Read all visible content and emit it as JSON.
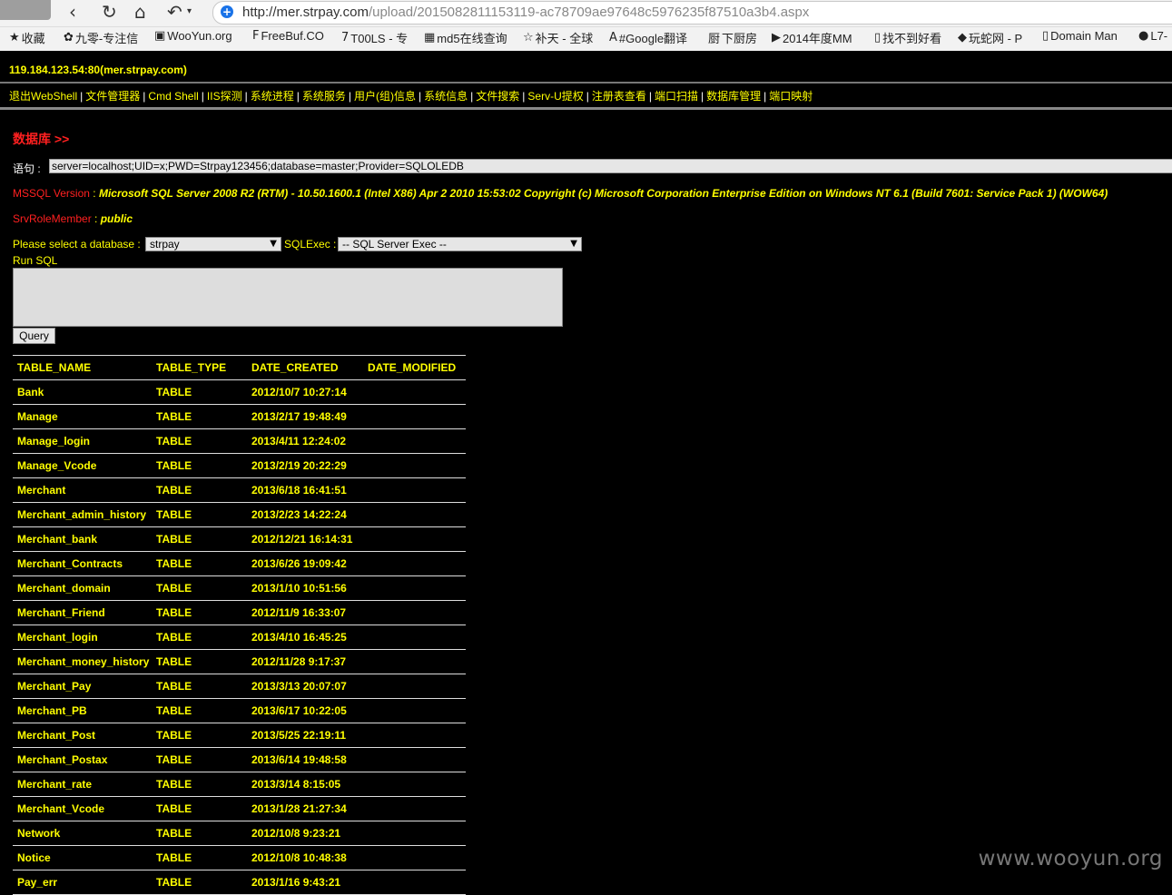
{
  "browser": {
    "url_host": "http://mer.strpay.com",
    "url_path": "/upload/2015082811153119-ac78709ae97648c5976235f87510a3b4.aspx",
    "bookmarks": [
      {
        "icon": "star-icon",
        "label": "收藏"
      },
      {
        "icon": "leaf-icon",
        "label": "九零-专注信"
      },
      {
        "icon": "page-icon",
        "label": "WooYun.org"
      },
      {
        "icon": "freebuf-icon",
        "label": "FreeBuf.CO"
      },
      {
        "icon": "seven-icon",
        "label": "T00LS - 专"
      },
      {
        "icon": "grid-icon",
        "label": "md5在线查询"
      },
      {
        "icon": "star-outline-icon",
        "label": "补天 - 全球"
      },
      {
        "icon": "translate-icon",
        "label": "#Google翻译"
      },
      {
        "icon": "kitchen-icon",
        "label": "下厨房"
      },
      {
        "icon": "play-icon",
        "label": "2014年度MM"
      },
      {
        "icon": "doc-icon",
        "label": "找不到好看"
      },
      {
        "icon": "python-icon",
        "label": "玩蛇网 - P"
      },
      {
        "icon": "doc-icon",
        "label": "Domain Man"
      },
      {
        "icon": "circle-icon",
        "label": "L7-"
      }
    ]
  },
  "header": {
    "host": "119.184.123.54:80(mer.strpay.com)"
  },
  "menu": [
    "退出WebShell",
    "文件管理器",
    "Cmd Shell",
    "IIS探测",
    "系统进程",
    "系统服务",
    "用户(组)信息",
    "系统信息",
    "文件搜索",
    "Serv-U提权",
    "注册表查看",
    "端口扫描",
    "数据库管理",
    "端口映射"
  ],
  "main": {
    "section_title": "数据库 >>",
    "statement_label": "语句 :",
    "statement_value": "server=localhost;UID=x;PWD=Strpay123456;database=master;Provider=SQLOLEDB",
    "mssql_label": "MSSQL Version",
    "mssql_value": "Microsoft SQL Server 2008 R2 (RTM) - 10.50.1600.1 (Intel X86) Apr 2 2010 15:53:02 Copyright (c) Microsoft Corporation Enterprise Edition on Windows NT 6.1 (Build 7601: Service Pack 1) (WOW64)",
    "role_label": "SrvRoleMember",
    "role_value": "public",
    "colon": " : ",
    "select_db_label": "Please select a database :",
    "select_db_value": "strpay",
    "sqlexec_label": "SQLExec :",
    "sqlexec_value": "-- SQL Server Exec --",
    "run_sql_label": "Run SQL",
    "query_button": "Query"
  },
  "table": {
    "columns": [
      "TABLE_NAME",
      "TABLE_TYPE",
      "DATE_CREATED",
      "DATE_MODIFIED"
    ],
    "rows": [
      [
        "Bank",
        "TABLE",
        "2012/10/7 10:27:14",
        ""
      ],
      [
        "Manage",
        "TABLE",
        "2013/2/17 19:48:49",
        ""
      ],
      [
        "Manage_login",
        "TABLE",
        "2013/4/11 12:24:02",
        ""
      ],
      [
        "Manage_Vcode",
        "TABLE",
        "2013/2/19 20:22:29",
        ""
      ],
      [
        "Merchant",
        "TABLE",
        "2013/6/18 16:41:51",
        ""
      ],
      [
        "Merchant_admin_history",
        "TABLE",
        "2013/2/23 14:22:24",
        ""
      ],
      [
        "Merchant_bank",
        "TABLE",
        "2012/12/21 16:14:31",
        ""
      ],
      [
        "Merchant_Contracts",
        "TABLE",
        "2013/6/26 19:09:42",
        ""
      ],
      [
        "Merchant_domain",
        "TABLE",
        "2013/1/10 10:51:56",
        ""
      ],
      [
        "Merchant_Friend",
        "TABLE",
        "2012/11/9 16:33:07",
        ""
      ],
      [
        "Merchant_login",
        "TABLE",
        "2013/4/10 16:45:25",
        ""
      ],
      [
        "Merchant_money_history",
        "TABLE",
        "2012/11/28 9:17:37",
        ""
      ],
      [
        "Merchant_Pay",
        "TABLE",
        "2013/3/13 20:07:07",
        ""
      ],
      [
        "Merchant_PB",
        "TABLE",
        "2013/6/17 10:22:05",
        ""
      ],
      [
        "Merchant_Post",
        "TABLE",
        "2013/5/25 22:19:11",
        ""
      ],
      [
        "Merchant_Postax",
        "TABLE",
        "2013/6/14 19:48:58",
        ""
      ],
      [
        "Merchant_rate",
        "TABLE",
        "2013/3/14 8:15:05",
        ""
      ],
      [
        "Merchant_Vcode",
        "TABLE",
        "2013/1/28 21:27:34",
        ""
      ],
      [
        "Network",
        "TABLE",
        "2012/10/8 9:23:21",
        ""
      ],
      [
        "Notice",
        "TABLE",
        "2012/10/8 10:48:38",
        ""
      ],
      [
        "Pay_err",
        "TABLE",
        "2013/1/16 9:43:21",
        ""
      ]
    ]
  },
  "watermark": "www.wooyun.org",
  "colors": {
    "background": "#000000",
    "text": "#ffff00",
    "accent": "#ff2020"
  }
}
